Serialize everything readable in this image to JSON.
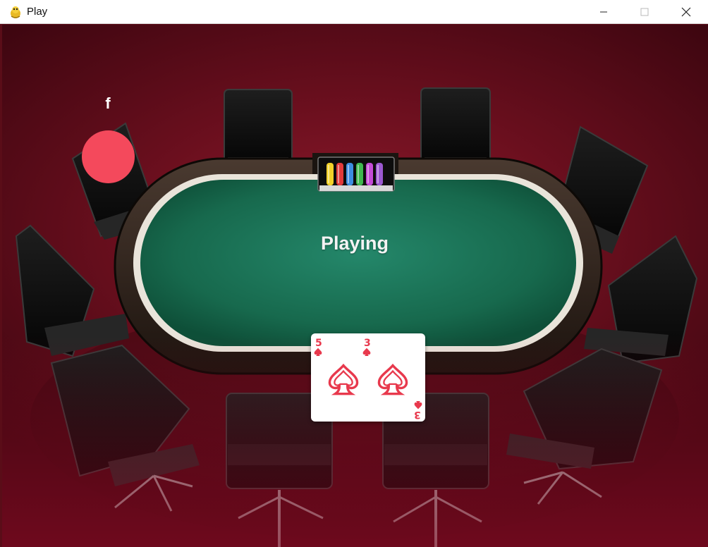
{
  "window": {
    "title": "Play",
    "icons": {
      "app": "pygame-snake-icon",
      "minimize": "minimize-icon",
      "maximize": "maximize-icon",
      "close": "close-icon"
    }
  },
  "player": {
    "name": "f",
    "marker_color": "#f4495c"
  },
  "table": {
    "status": "Playing",
    "felt_color": "#1d7a5b",
    "chip_colors": [
      "#f2d12a",
      "#e23a3a",
      "#3d8de0",
      "#3fb84f",
      "#c34bd6",
      "#9b59d0"
    ]
  },
  "card": {
    "left": {
      "rank": "5",
      "suit": "spade-icon"
    },
    "right": {
      "rank": "3",
      "suit": "spade-icon"
    },
    "color": "#e8394d"
  }
}
